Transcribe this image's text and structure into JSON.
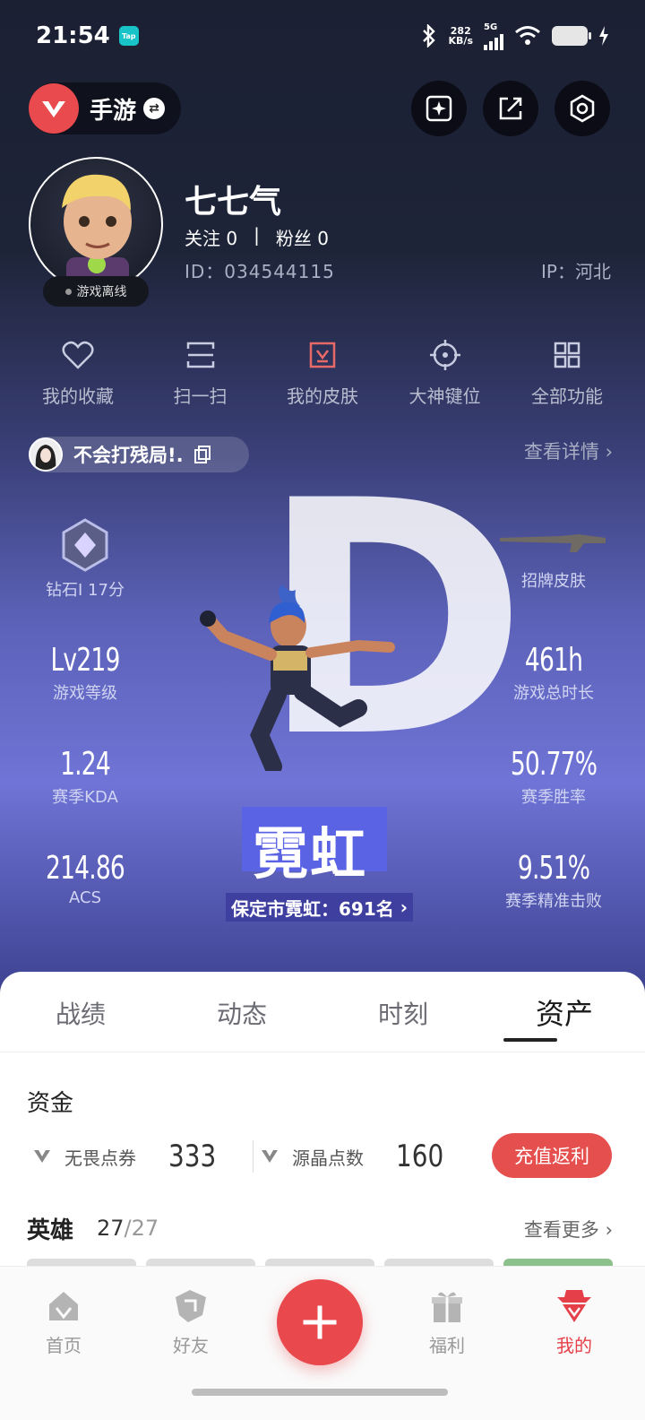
{
  "status_bar": {
    "time": "21:54",
    "app_badge": "Tap",
    "net_speed_value": "282",
    "net_speed_unit": "KB/s",
    "network": "5G"
  },
  "header": {
    "game_name": "手游",
    "profile": {
      "nickname": "七七气",
      "follow_label": "关注",
      "follow_count": "0",
      "fans_label": "粉丝",
      "fans_count": "0",
      "separator": "|",
      "id_text": "ID：034544115",
      "ip_text": "IP：河北",
      "online_status": "游戏离线"
    }
  },
  "quick_actions": [
    {
      "label": "我的收藏",
      "icon": "heart-icon"
    },
    {
      "label": "扫一扫",
      "icon": "scan-icon"
    },
    {
      "label": "我的皮肤",
      "icon": "skin-icon"
    },
    {
      "label": "大神键位",
      "icon": "crosshair-icon"
    },
    {
      "label": "全部功能",
      "icon": "grid-icon"
    }
  ],
  "team": {
    "name": "不会打残局!.",
    "detail_link": "查看详情"
  },
  "rank_letter": "D",
  "stats": {
    "rank": {
      "label": "钻石I 17分"
    },
    "skin": {
      "label": "招牌皮肤"
    },
    "level": {
      "value": "Lv219",
      "label": "游戏等级"
    },
    "playtime": {
      "value": "461h",
      "label": "游戏总时长"
    },
    "kda": {
      "value": "1.24",
      "label": "赛季KDA"
    },
    "winrate": {
      "value": "50.77%",
      "label": "赛季胜率"
    },
    "acs": {
      "value": "214.86",
      "label": "ACS"
    },
    "headshot": {
      "value": "9.51%",
      "label": "赛季精准击败"
    }
  },
  "agent": {
    "name": "霓虹",
    "regional_rank": "保定市霓虹：691名"
  },
  "tabs": {
    "items": [
      "战绩",
      "动态",
      "时刻",
      "资产"
    ],
    "active_index": 3
  },
  "funds": {
    "title": "资金",
    "items": [
      {
        "name": "无畏点券",
        "value": "333"
      },
      {
        "name": "源晶点数",
        "value": "160"
      }
    ],
    "topup_label": "充值返利"
  },
  "heroes": {
    "title": "英雄",
    "owned": "27",
    "slash": "/",
    "total": "27",
    "more_link": "查看更多"
  },
  "bottom_nav": {
    "items": [
      {
        "label": "首页",
        "icon": "home-icon"
      },
      {
        "label": "好友",
        "icon": "friends-icon"
      },
      {
        "label": "福利",
        "icon": "gift-icon"
      },
      {
        "label": "我的",
        "icon": "profile-icon"
      }
    ],
    "active_index": 3,
    "fab_icon": "plus-icon"
  },
  "colors": {
    "accent_red": "#e5504f",
    "hero_gradient_top": "#1b2033",
    "hero_gradient_mid": "#6f74d6",
    "agent_box": "#5b63e5"
  }
}
